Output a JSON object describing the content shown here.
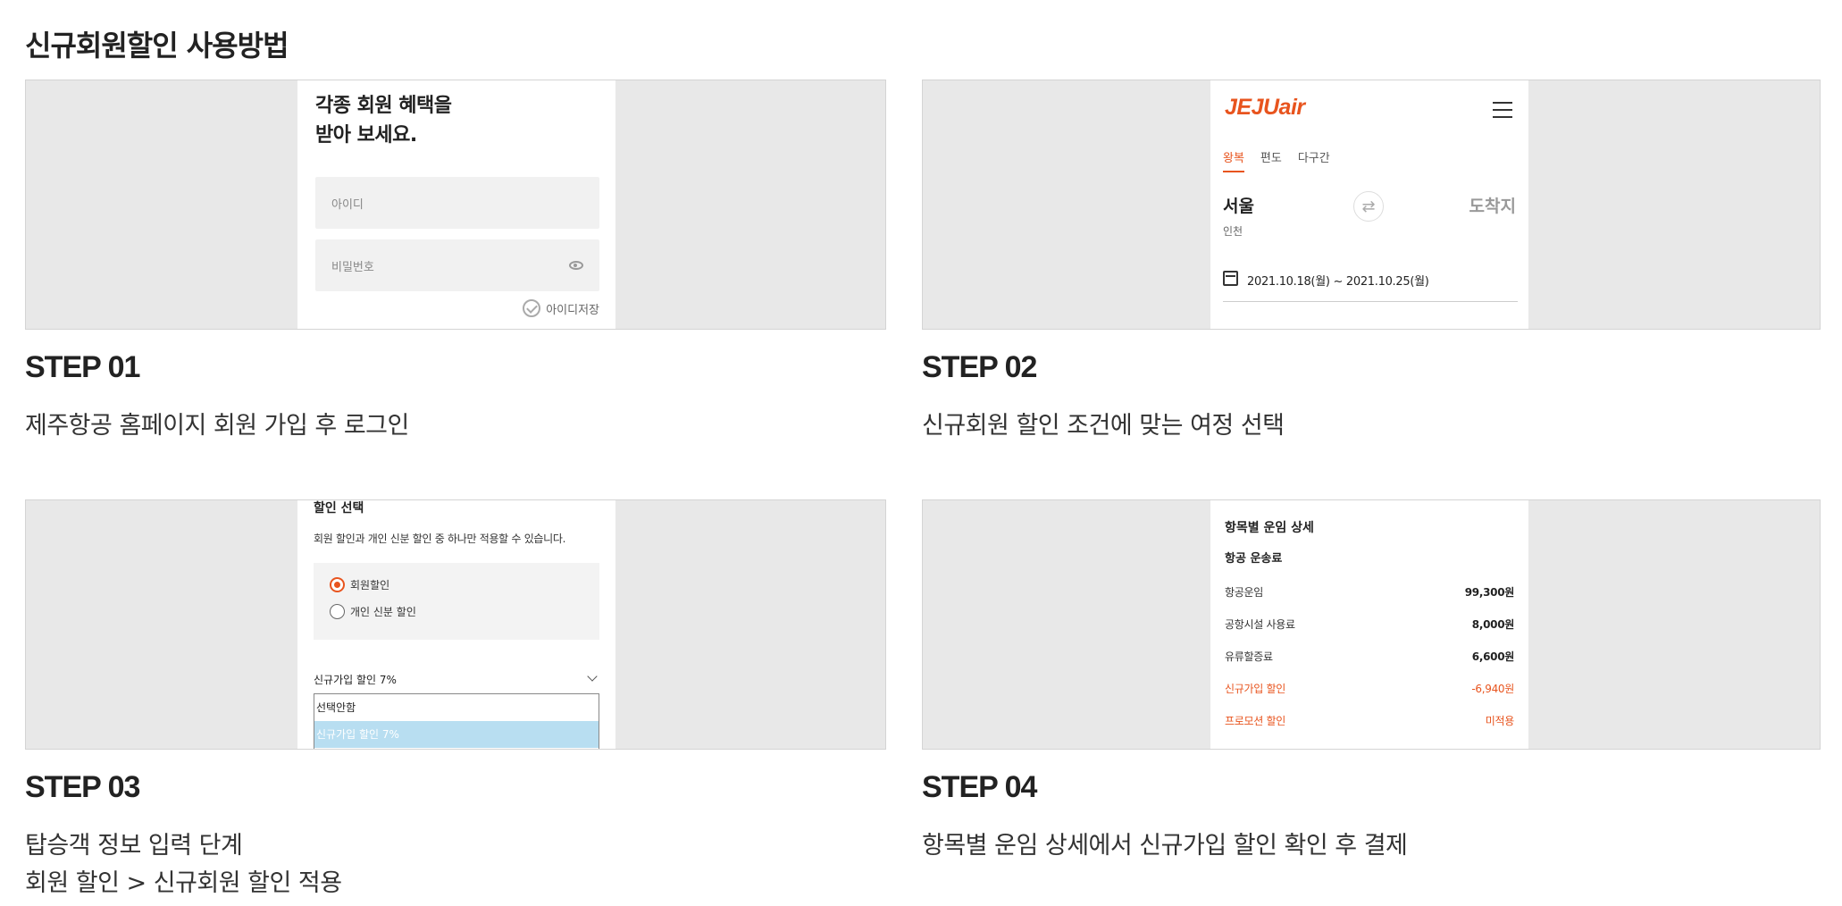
{
  "page_title": "신규회원할인 사용방법",
  "colors": {
    "accent": "#e8541e",
    "panel_bg": "#e8e8e8",
    "highlight": "#b8def1"
  },
  "steps": [
    {
      "title": "STEP 01",
      "desc": [
        "제주항공 홈페이지 회원 가입 후 로그인"
      ],
      "login": {
        "heading_line1": "각종 회원 혜택을",
        "heading_line2": "받아 보세요.",
        "id_placeholder": "아이디",
        "pw_placeholder": "비밀번호",
        "save_id": "아이디저장",
        "icons": [
          "eye-icon",
          "check-icon"
        ]
      }
    },
    {
      "title": "STEP 02",
      "desc": [
        "신규회원 할인 조건에 맞는 여정 선택"
      ],
      "search": {
        "logo": "JEJUair",
        "tabs": [
          "왕복",
          "편도",
          "다구간"
        ],
        "active_tab": "왕복",
        "origin": "서울",
        "origin_sub": "인천",
        "destination": "도착지",
        "dates": "2021.10.18(월) ~ 2021.10.25(월)",
        "icons": [
          "menu-icon",
          "swap-icon",
          "calendar-icon"
        ]
      }
    },
    {
      "title": "STEP 03",
      "desc": [
        "탑승객 정보 입력 단계",
        "회원 할인 > 신규회원 할인 적용"
      ],
      "discount": {
        "title": "할인 선택",
        "description": "회원 할인과 개인 신분 할인 중 하나만 적용할 수 있습니다.",
        "options": [
          "회원할인",
          "개인 신분 할인"
        ],
        "checked_option": "회원할인",
        "select_label": "신규가입 할인 7%",
        "dropdown_options": [
          "선택안함",
          "신규가입 할인 7%"
        ],
        "highlighted_option": "신규가입 할인 7%"
      }
    },
    {
      "title": "STEP 04",
      "desc": [
        "항목별 운임 상세에서 신규가입 할인 확인 후 결제"
      ],
      "fare": {
        "title": "항목별 운임 상세",
        "subtitle": "항공 운송료",
        "rows": [
          {
            "label": "항공운임",
            "amount": "99,300원",
            "highlight": false
          },
          {
            "label": "공항시설 사용료",
            "amount": "8,000원",
            "highlight": false
          },
          {
            "label": "유류할증료",
            "amount": "6,600원",
            "highlight": false
          },
          {
            "label": "신규가입 할인",
            "amount": "-6,940원",
            "highlight": true
          },
          {
            "label": "프로모션 할인",
            "amount": "미적용",
            "highlight": true
          }
        ]
      }
    }
  ]
}
